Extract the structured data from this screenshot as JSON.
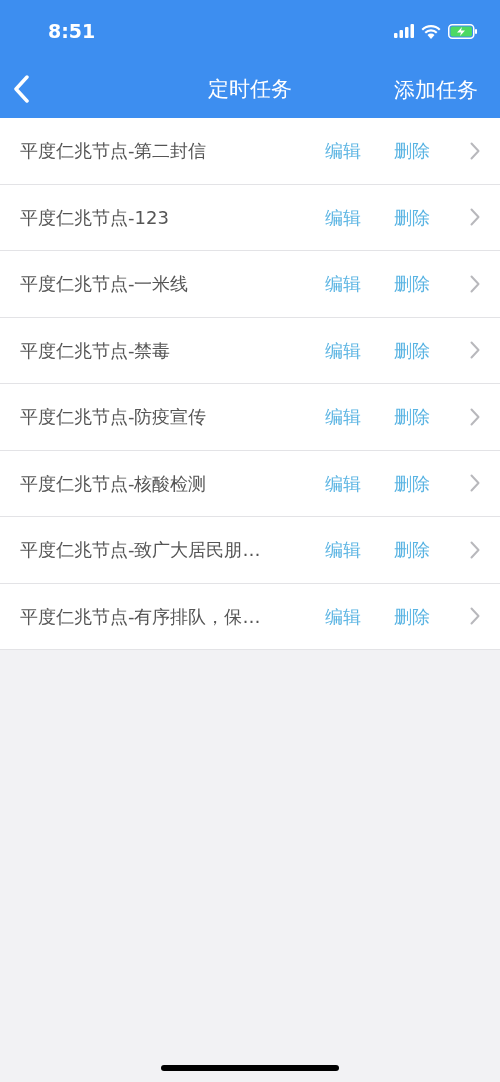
{
  "status_bar": {
    "time": "8:51"
  },
  "nav_bar": {
    "title": "定时任务",
    "action": "添加任务"
  },
  "tasks": [
    {
      "name": "平度仁兆节点-第二封信",
      "edit": "编辑",
      "delete": "删除"
    },
    {
      "name": "平度仁兆节点-123",
      "edit": "编辑",
      "delete": "删除"
    },
    {
      "name": "平度仁兆节点-一米线",
      "edit": "编辑",
      "delete": "删除"
    },
    {
      "name": "平度仁兆节点-禁毒",
      "edit": "编辑",
      "delete": "删除"
    },
    {
      "name": "平度仁兆节点-防疫宣传",
      "edit": "编辑",
      "delete": "删除"
    },
    {
      "name": "平度仁兆节点-核酸检测",
      "edit": "编辑",
      "delete": "删除"
    },
    {
      "name": "平度仁兆节点-致广大居民朋…",
      "edit": "编辑",
      "delete": "删除"
    },
    {
      "name": "平度仁兆节点-有序排队，保…",
      "edit": "编辑",
      "delete": "删除"
    }
  ]
}
